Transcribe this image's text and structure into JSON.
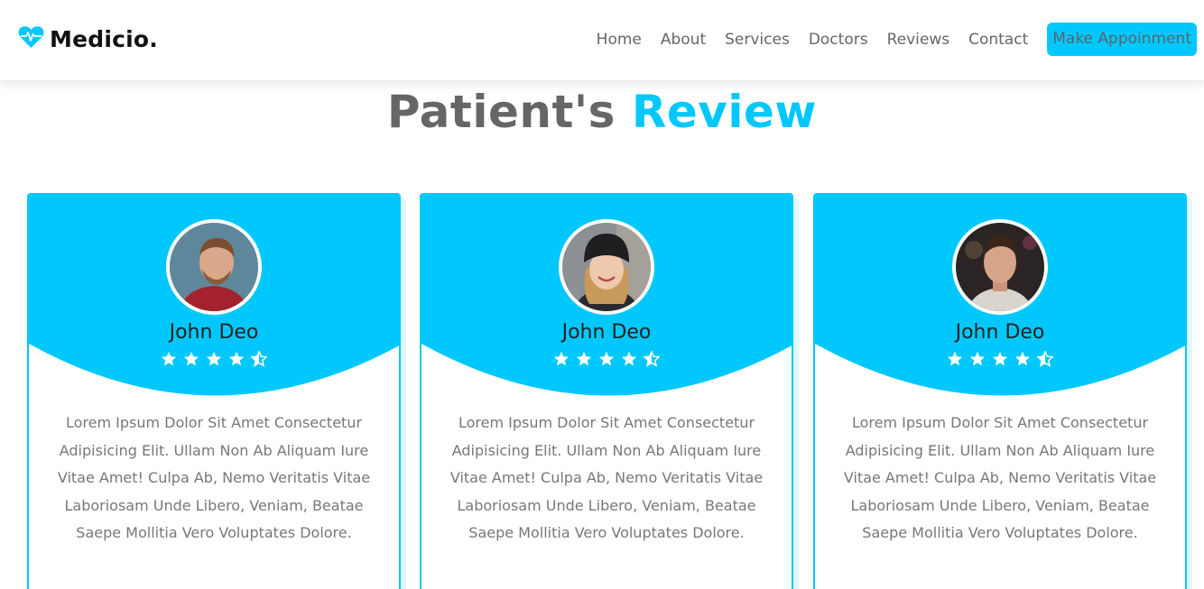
{
  "brand": {
    "name": "Medicio.",
    "icon": "heartbeat-icon"
  },
  "nav": {
    "links": [
      "Home",
      "About",
      "Services",
      "Doctors",
      "Reviews",
      "Contact"
    ],
    "cta": "Make Appoinment"
  },
  "section": {
    "title_main": "Patient's",
    "title_accent": "Review"
  },
  "colors": {
    "accent": "#00c8fc",
    "text": "#666666",
    "white": "#ffffff"
  },
  "reviews": [
    {
      "name": "John Deo",
      "rating": 4.5,
      "text": "Lorem Ipsum Dolor Sit Amet Consectetur Adipisicing Elit. Ullam Non Ab Aliquam Iure Vitae Amet! Culpa Ab, Nemo Veritatis Vitae Laboriosam Unde Libero, Veniam, Beatae Saepe Mollitia Vero Voluptates Dolore."
    },
    {
      "name": "John Deo",
      "rating": 4.5,
      "text": "Lorem Ipsum Dolor Sit Amet Consectetur Adipisicing Elit. Ullam Non Ab Aliquam Iure Vitae Amet! Culpa Ab, Nemo Veritatis Vitae Laboriosam Unde Libero, Veniam, Beatae Saepe Mollitia Vero Voluptates Dolore."
    },
    {
      "name": "John Deo",
      "rating": 4.5,
      "text": "Lorem Ipsum Dolor Sit Amet Consectetur Adipisicing Elit. Ullam Non Ab Aliquam Iure Vitae Amet! Culpa Ab, Nemo Veritatis Vitae Laboriosam Unde Libero, Veniam, Beatae Saepe Mollitia Vero Voluptates Dolore."
    }
  ]
}
